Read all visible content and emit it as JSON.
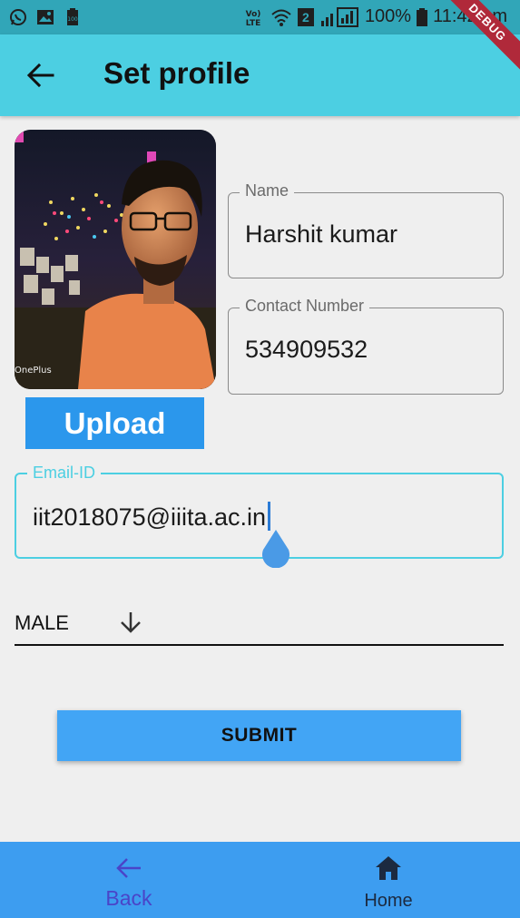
{
  "status_bar": {
    "battery": "100%",
    "time": "11:42 pm",
    "sim_badge": "2",
    "debug_banner": "DEBUG",
    "icons": [
      "whatsapp-icon",
      "gallery-icon",
      "battery-saver-icon",
      "volte-icon",
      "wifi-icon",
      "signal-icon",
      "battery-icon"
    ]
  },
  "app_bar": {
    "title": "Set profile",
    "back_icon": "arrow-back-icon"
  },
  "photo": {
    "watermark": "OnePlus"
  },
  "upload_button": {
    "label": "Upload"
  },
  "form": {
    "name": {
      "label": "Name",
      "value": "Harshit kumar"
    },
    "contact": {
      "label": "Contact Number",
      "value": "534909532"
    },
    "email": {
      "label": "Email-ID",
      "value": "iit2018075@iiita.ac.in"
    },
    "gender": {
      "value": "MALE",
      "icon": "arrow-down-icon"
    }
  },
  "submit_button": {
    "label": "SUBMIT"
  },
  "bottom_nav": {
    "items": [
      {
        "label": "Back",
        "icon": "arrow-back-icon"
      },
      {
        "label": "Home",
        "icon": "home-icon"
      }
    ]
  },
  "colors": {
    "app_bar": "#4ccfe2",
    "status_bar": "#31a6b8",
    "upload": "#2b97ec",
    "submit": "#42a5f5",
    "bottom_nav": "#3d9df0",
    "focus": "#4ccfe2",
    "debug": "#b0293a"
  }
}
